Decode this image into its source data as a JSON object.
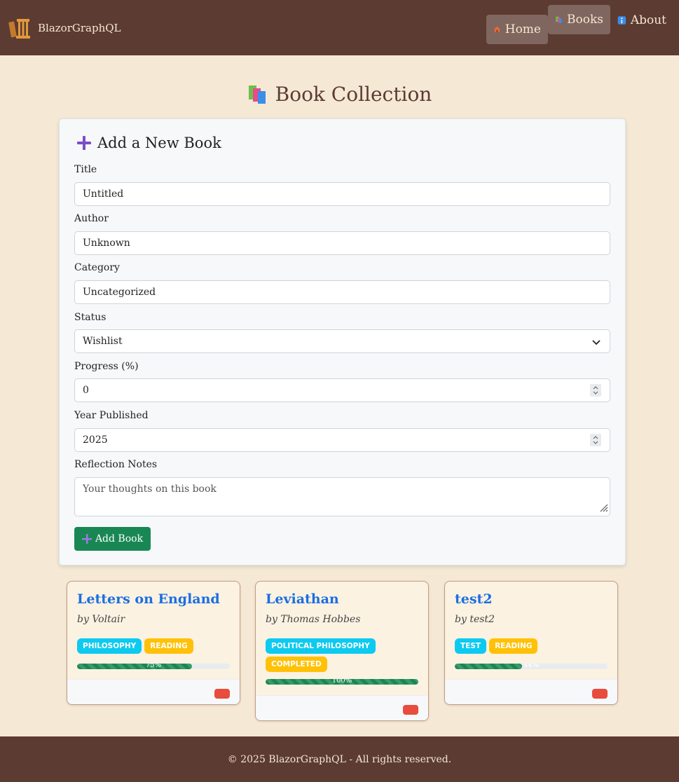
{
  "header": {
    "brand": "BlazorGraphQL",
    "nav": [
      {
        "label": "Home",
        "icon": "house-icon"
      },
      {
        "label": "Books",
        "icon": "books-icon"
      },
      {
        "label": "About",
        "icon": "info-icon"
      }
    ]
  },
  "page_title": "Book Collection",
  "form": {
    "title": "Add a New Book",
    "title_label": "Title",
    "title_value": "Untitled",
    "author_label": "Author",
    "author_value": "Unknown",
    "category_label": "Category",
    "category_value": "Uncategorized",
    "status_label": "Status",
    "status_value": "Wishlist",
    "progress_label": "Progress (%)",
    "progress_value": "0",
    "year_label": "Year Published",
    "year_value": "2025",
    "notes_label": "Reflection Notes",
    "notes_placeholder": "Your thoughts on this book",
    "submit_label": "Add Book"
  },
  "books": [
    {
      "title": "Letters on England",
      "author": "by Voltair",
      "tags": [
        "PHILOSOPHY",
        "READING"
      ],
      "progress": 75,
      "progress_label": "75%"
    },
    {
      "title": "Leviathan",
      "author": "by Thomas Hobbes",
      "tags": [
        "POLITICAL PHILOSOPHY",
        "COMPLETED"
      ],
      "progress": 100,
      "progress_label": "100%"
    },
    {
      "title": "test2",
      "author": "by test2",
      "tags": [
        "TEST",
        "READING"
      ],
      "progress": 44,
      "progress_label": "44%"
    }
  ],
  "colors": {
    "header_bg": "#5c3b33",
    "page_bg": "#f5e9d6",
    "primary_link": "#1a6fe0",
    "success": "#198754",
    "danger": "#e74c3c",
    "tag_category": "#0dcaf0",
    "tag_status": "#ffc107"
  },
  "footer": {
    "text": "© 2025 BlazorGraphQL - All rights reserved."
  }
}
